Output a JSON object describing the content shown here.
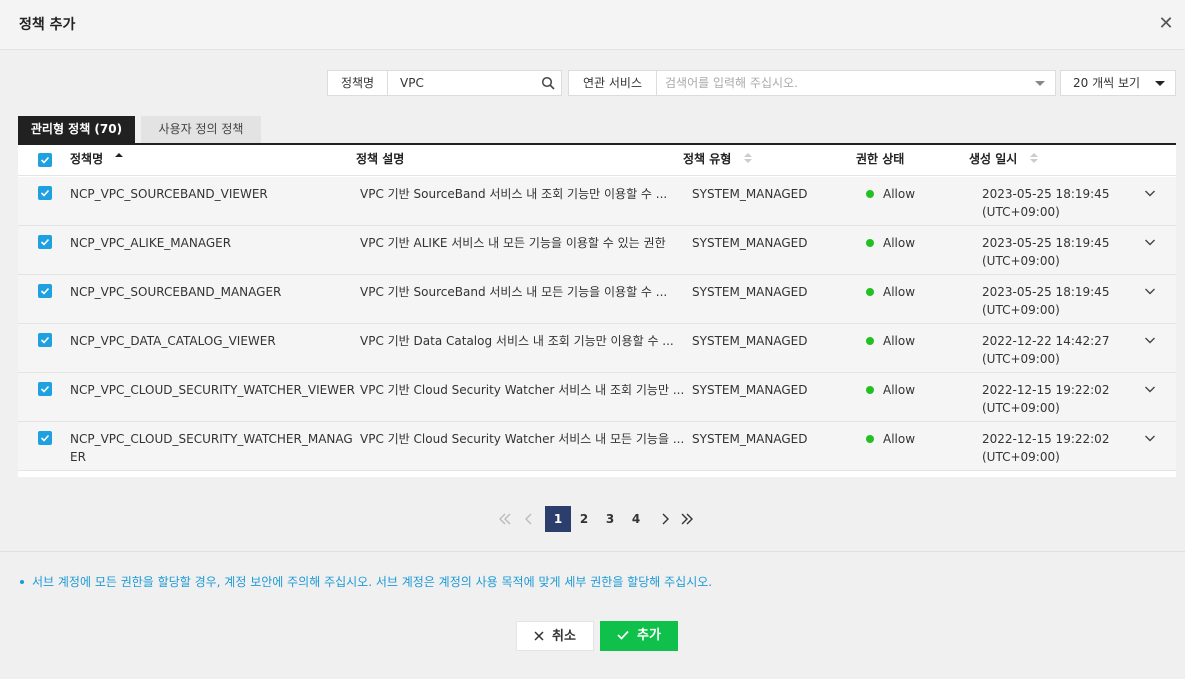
{
  "modal": {
    "title": "정책 추가",
    "close_symbol": "✕"
  },
  "filters": {
    "policy_name_label": "정책명",
    "policy_name_value": "VPC",
    "service_label": "연관 서비스",
    "service_placeholder": "검색어를 입력해 주십시오.",
    "page_size_label": "20 개씩 보기"
  },
  "tabs": [
    {
      "label": "관리형 정책 (70)",
      "active": true
    },
    {
      "label": "사용자 정의 정책",
      "active": false
    }
  ],
  "table": {
    "columns": [
      "정책명",
      "정책 설명",
      "정책 유형",
      "권한 상태",
      "생성 일시"
    ],
    "rows": [
      {
        "name": "NCP_VPC_SOURCEBAND_VIEWER",
        "name2": "",
        "desc": "VPC 기반 SourceBand 서비스 내 조회 기능만 이용할 수 ...",
        "type": "SYSTEM_MANAGED",
        "status": "Allow",
        "date": "2023-05-25 18:19:45",
        "tz": "(UTC+09:00)"
      },
      {
        "name": "NCP_VPC_ALIKE_MANAGER",
        "name2": "",
        "desc": "VPC 기반 ALIKE 서비스 내 모든 기능을 이용할 수 있는 권한",
        "type": "SYSTEM_MANAGED",
        "status": "Allow",
        "date": "2023-05-25 18:19:45",
        "tz": "(UTC+09:00)"
      },
      {
        "name": "NCP_VPC_SOURCEBAND_MANAGER",
        "name2": "",
        "desc": "VPC 기반 SourceBand 서비스 내 모든 기능을 이용할 수 ...",
        "type": "SYSTEM_MANAGED",
        "status": "Allow",
        "date": "2023-05-25 18:19:45",
        "tz": "(UTC+09:00)"
      },
      {
        "name": "NCP_VPC_DATA_CATALOG_VIEWER",
        "name2": "",
        "desc": "VPC 기반 Data Catalog 서비스 내 조회 기능만 이용할 수 ...",
        "type": "SYSTEM_MANAGED",
        "status": "Allow",
        "date": "2022-12-22 14:42:27",
        "tz": "(UTC+09:00)"
      },
      {
        "name": "NCP_VPC_CLOUD_SECURITY_WATCHER_VIEWER",
        "name2": "",
        "desc": "VPC 기반 Cloud Security Watcher 서비스 내 조회 기능만 ...",
        "type": "SYSTEM_MANAGED",
        "status": "Allow",
        "date": "2022-12-15 19:22:02",
        "tz": "(UTC+09:00)"
      },
      {
        "name": "NCP_VPC_CLOUD_SECURITY_WATCHER_MANAG",
        "name2": "ER",
        "desc": "VPC 기반 Cloud Security Watcher 서비스 내 모든 기능을 ...",
        "type": "SYSTEM_MANAGED",
        "status": "Allow",
        "date": "2022-12-15 19:22:02",
        "tz": "(UTC+09:00)"
      }
    ]
  },
  "pagination": {
    "pages": [
      "1",
      "2",
      "3",
      "4"
    ],
    "current": "1"
  },
  "notice": "서브 계정에 모든 권한을 할당할 경우, 계정 보안에 주의해 주십시오. 서브 계정은 계정의 사용 목적에 맞게 세부 권한을 할당해 주십시오.",
  "buttons": {
    "cancel": "취소",
    "add": "추가"
  },
  "colors": {
    "accent_blue": "#1fa0e0",
    "status_green": "#22c022",
    "add_green": "#0fc04a",
    "pager_active": "#2c3e6b"
  }
}
